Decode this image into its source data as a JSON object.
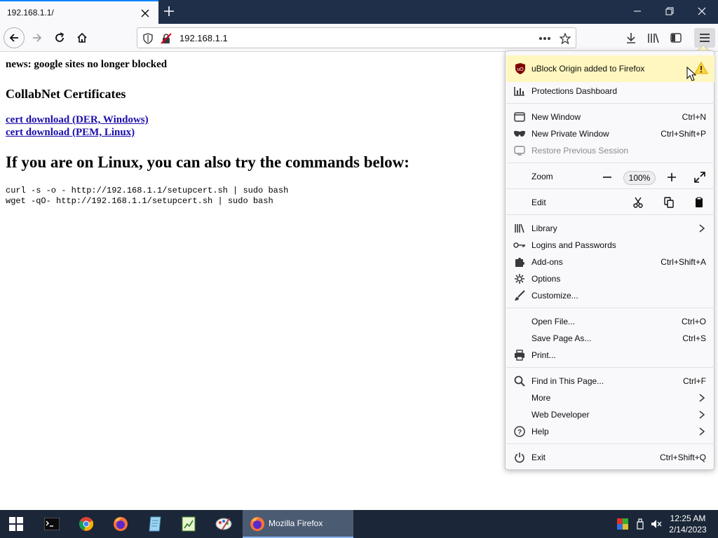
{
  "browser": {
    "tab_title": "192.168.1.1/",
    "url": "192.168.1.1"
  },
  "page": {
    "news": "news: google sites no longer blocked",
    "cert_heading": "CollabNet Certificates",
    "link_der": "cert download (DER, Windows)",
    "link_pem": "cert download (PEM, Linux)",
    "linux_heading": "If you are on Linux, you can also try the commands below:",
    "cmd_curl": "curl -s -o - http://192.168.1.1/setupcert.sh | sudo bash",
    "cmd_wget": "wget -qO- http://192.168.1.1/setupcert.sh | sudo bash"
  },
  "menu": {
    "banner": "uBlock Origin added to Firefox",
    "protections": "Protections Dashboard",
    "new_window": {
      "label": "New Window",
      "shortcut": "Ctrl+N"
    },
    "new_private": {
      "label": "New Private Window",
      "shortcut": "Ctrl+Shift+P"
    },
    "restore": "Restore Previous Session",
    "zoom_label": "Zoom",
    "zoom_value": "100%",
    "edit_label": "Edit",
    "library": "Library",
    "logins": "Logins and Passwords",
    "addons": {
      "label": "Add-ons",
      "shortcut": "Ctrl+Shift+A"
    },
    "options": "Options",
    "customize": "Customize...",
    "open_file": {
      "label": "Open File...",
      "shortcut": "Ctrl+O"
    },
    "save_page": {
      "label": "Save Page As...",
      "shortcut": "Ctrl+S"
    },
    "print": "Print...",
    "find": {
      "label": "Find in This Page...",
      "shortcut": "Ctrl+F"
    },
    "more": "More",
    "web_dev": "Web Developer",
    "help": "Help",
    "exit": {
      "label": "Exit",
      "shortcut": "Ctrl+Shift+Q"
    }
  },
  "taskbar": {
    "active_app": "Mozilla Firefox",
    "time": "12:25 AM",
    "date": "2/14/2023"
  },
  "colors": {
    "tabstrip": "#1f2f4a",
    "taskbar": "#1b2738",
    "banner": "#fff7bf",
    "link": "#1a0dab"
  }
}
